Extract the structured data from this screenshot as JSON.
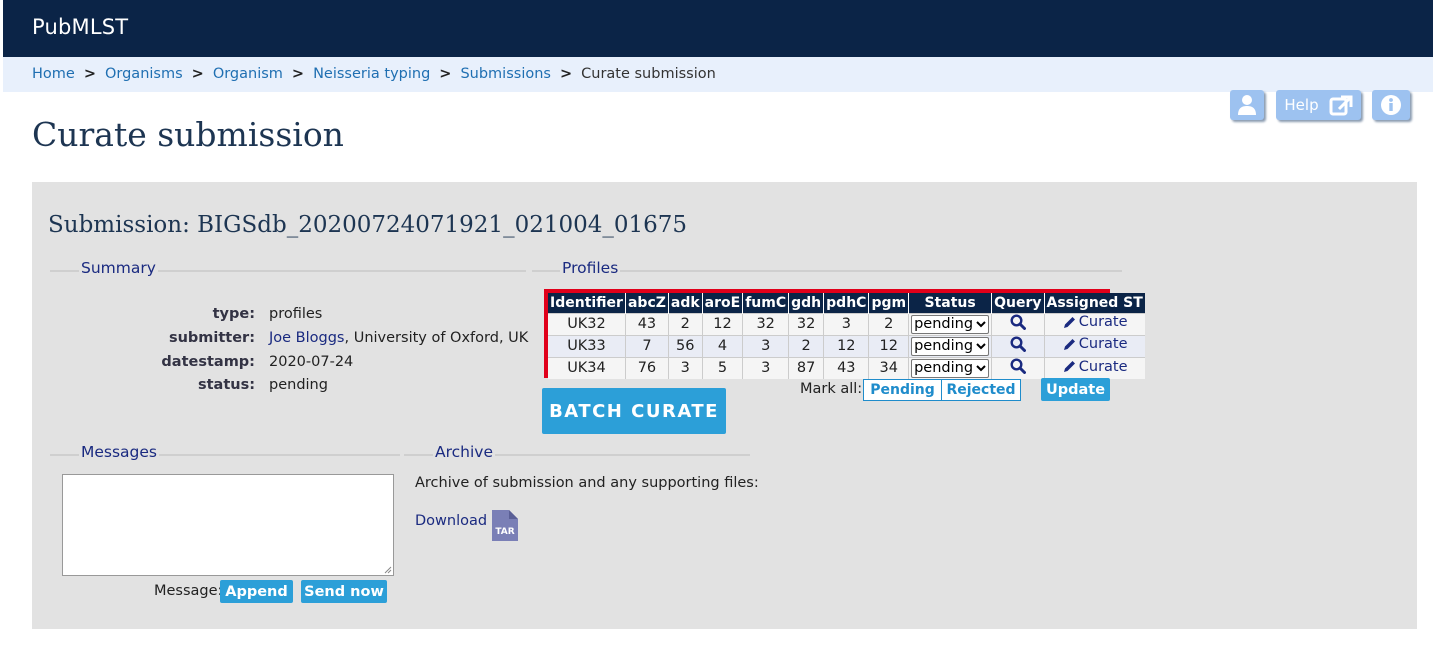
{
  "site": {
    "brand": "PubMLST"
  },
  "breadcrumb": {
    "items": [
      "Home",
      "Organisms",
      "Organism",
      "Neisseria typing",
      "Submissions"
    ],
    "current": "Curate submission",
    "separator": ">"
  },
  "toolbar": {
    "help_label": "Help"
  },
  "page": {
    "title": "Curate submission"
  },
  "submission": {
    "title": "Submission: BIGSdb_20200724071921_021004_01675"
  },
  "summary": {
    "legend": "Summary",
    "type_label": "type:",
    "type_value": "profiles",
    "submitter_label": "submitter:",
    "submitter_name": "Joe Bloggs",
    "submitter_rest": ", University of Oxford, UK",
    "datestamp_label": "datestamp:",
    "datestamp_value": "2020-07-24",
    "status_label": "status:",
    "status_value": "pending"
  },
  "profiles": {
    "legend": "Profiles",
    "headers": [
      "Identifier",
      "abcZ",
      "adk",
      "aroE",
      "fumC",
      "gdh",
      "pdhC",
      "pgm",
      "Status",
      "Query",
      "Assigned ST"
    ],
    "rows": [
      {
        "id": "UK32",
        "abcZ": "43",
        "adk": "2",
        "aroE": "12",
        "fumC": "32",
        "gdh": "32",
        "pdhC": "3",
        "pgm": "2",
        "status": "pending",
        "action": "Curate"
      },
      {
        "id": "UK33",
        "abcZ": "7",
        "adk": "56",
        "aroE": "4",
        "fumC": "3",
        "gdh": "2",
        "pdhC": "12",
        "pgm": "12",
        "status": "pending",
        "action": "Curate"
      },
      {
        "id": "UK34",
        "abcZ": "76",
        "adk": "3",
        "aroE": "5",
        "fumC": "3",
        "gdh": "87",
        "pdhC": "43",
        "pgm": "34",
        "status": "pending",
        "action": "Curate"
      }
    ],
    "mark_all_label": "Mark all:",
    "pending_button": "Pending",
    "rejected_button": "Rejected",
    "update_button": "Update",
    "batch_button": "BATCH CURATE"
  },
  "messages": {
    "legend": "Messages",
    "message_label": "Message:",
    "append_button": "Append",
    "send_button": "Send now"
  },
  "archive": {
    "legend": "Archive",
    "text": "Archive of submission and any supporting files:",
    "download_label": "Download",
    "icon_text": "TAR"
  },
  "colors": {
    "header_navy": "#0b2447",
    "breadcrumb_bg": "#e8f0fc",
    "highlight_red": "#e0001a",
    "button_blue": "#2c9fd8"
  }
}
